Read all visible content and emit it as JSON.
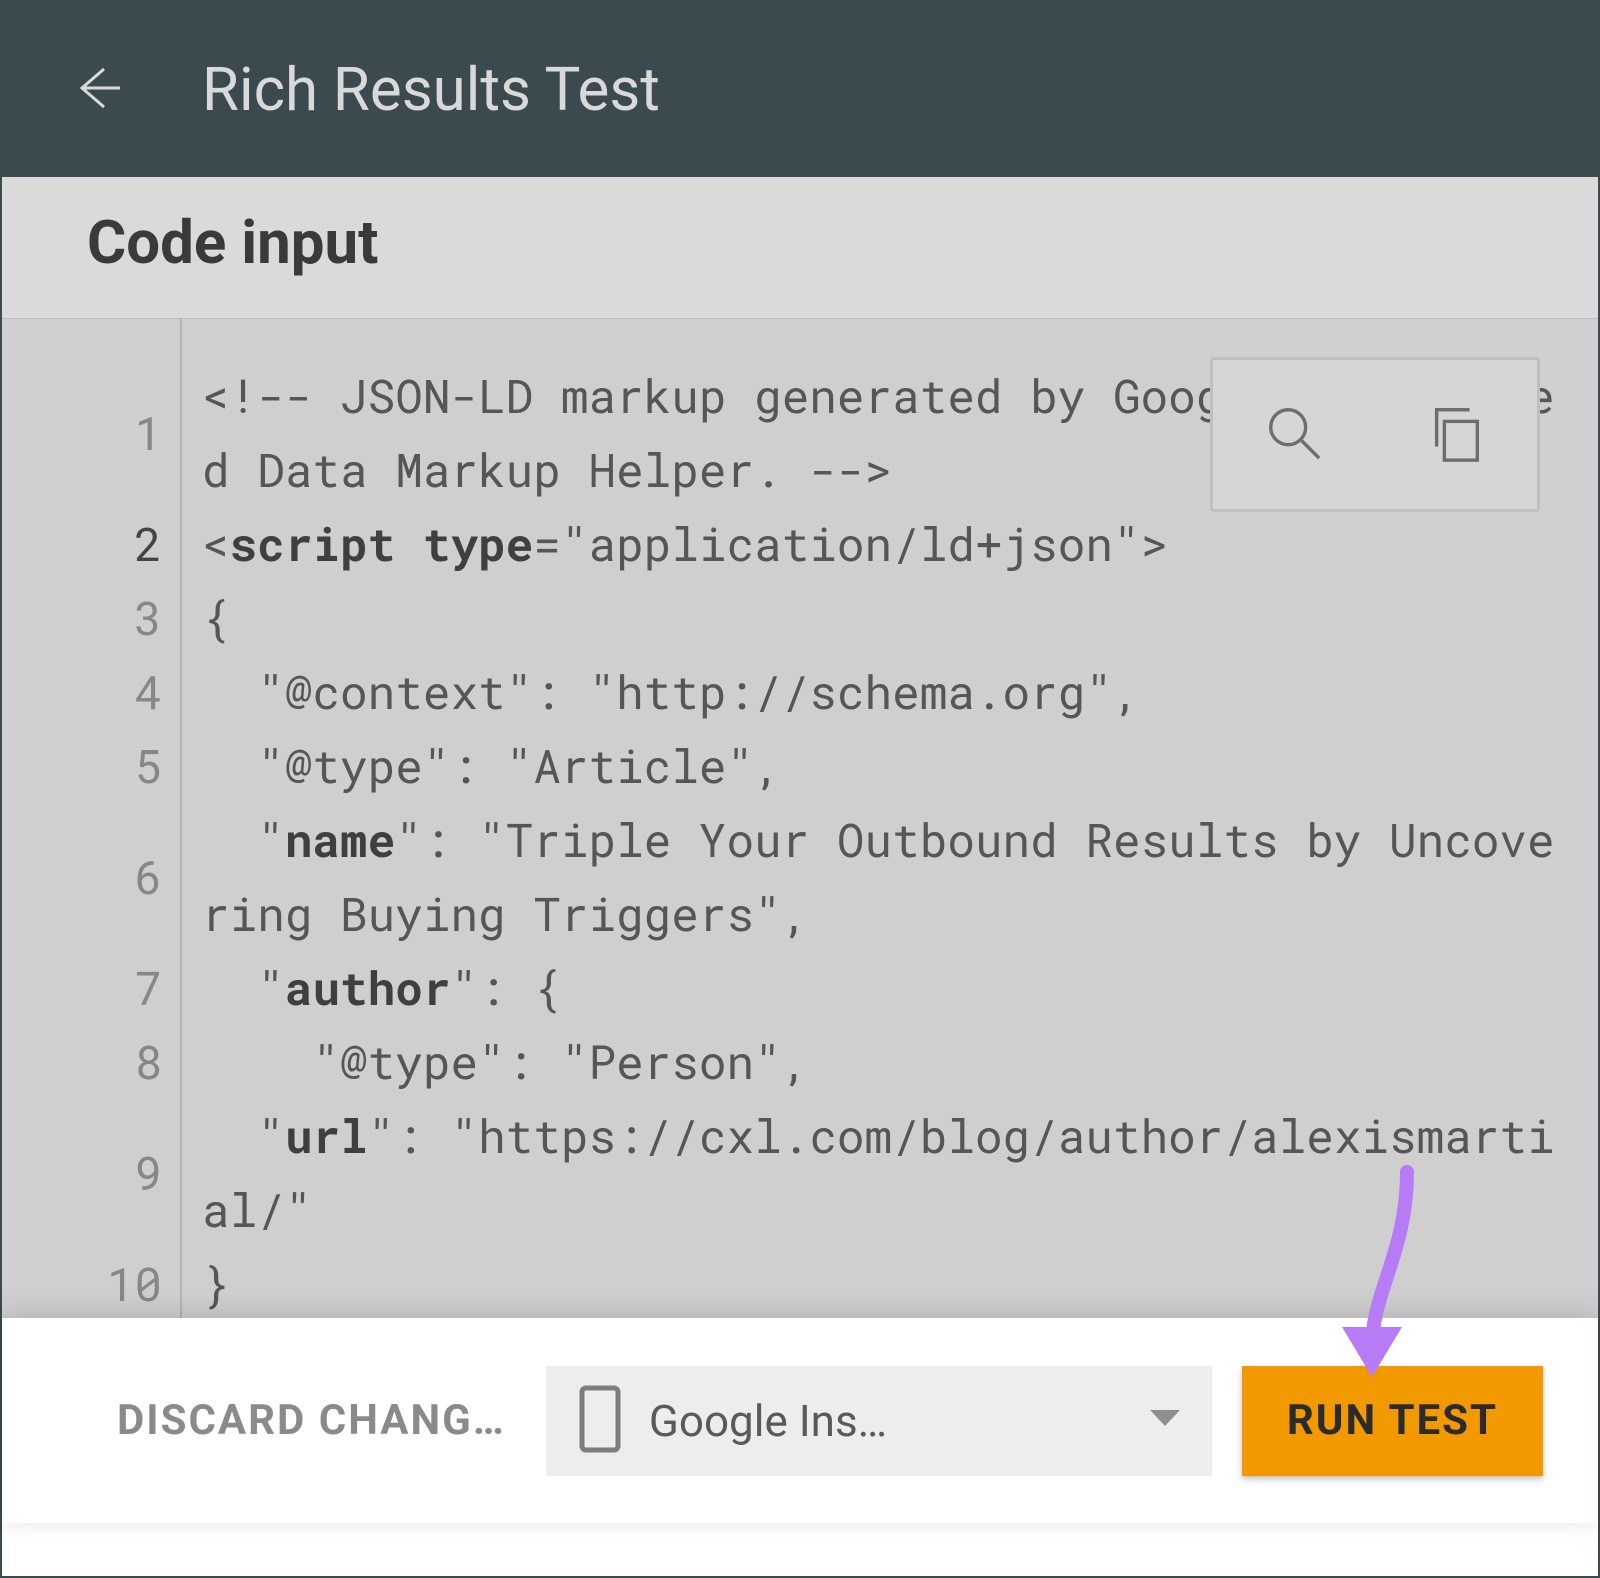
{
  "header": {
    "title": "Rich Results Test"
  },
  "section": {
    "title": "Code input"
  },
  "code": {
    "lines": [
      {
        "n": "1",
        "parts": [
          {
            "t": "<!-- JSON-LD markup generated by Google Structured Data Markup Helper. -->"
          }
        ],
        "wrap": true
      },
      {
        "n": "2",
        "parts": [
          {
            "t": "<",
            "b": false
          },
          {
            "t": "script type",
            "b": true
          },
          {
            "t": "=\"application/ld+json\">"
          }
        ]
      },
      {
        "n": "3",
        "parts": [
          {
            "t": "{"
          }
        ]
      },
      {
        "n": "4",
        "parts": [
          {
            "t": "  \"@context\": \"http://schema.org\","
          }
        ]
      },
      {
        "n": "5",
        "parts": [
          {
            "t": "  \"@type\": \"Article\","
          }
        ]
      },
      {
        "n": "6",
        "parts": [
          {
            "t": "  \""
          },
          {
            "t": "name",
            "b": true
          },
          {
            "t": "\": \"Triple Your Outbound Results by Uncovering Buying Triggers\","
          }
        ],
        "wrap": true
      },
      {
        "n": "7",
        "parts": [
          {
            "t": "  \""
          },
          {
            "t": "author",
            "b": true
          },
          {
            "t": "\": {"
          }
        ]
      },
      {
        "n": "8",
        "parts": [
          {
            "t": "    \"@type\": \"Person\","
          }
        ]
      },
      {
        "n": "9",
        "parts": [
          {
            "t": "  \""
          },
          {
            "t": "url",
            "b": true
          },
          {
            "t": "\": \"https://cxl.com/blog/author/alexismartial/\""
          }
        ],
        "wrap": true
      },
      {
        "n": "10",
        "parts": [
          {
            "t": "}"
          }
        ]
      }
    ],
    "active_line": "2"
  },
  "footer": {
    "discard_label": "DISCARD CHANG…",
    "device_label": "Google Ins…",
    "run_label": "RUN TEST"
  }
}
